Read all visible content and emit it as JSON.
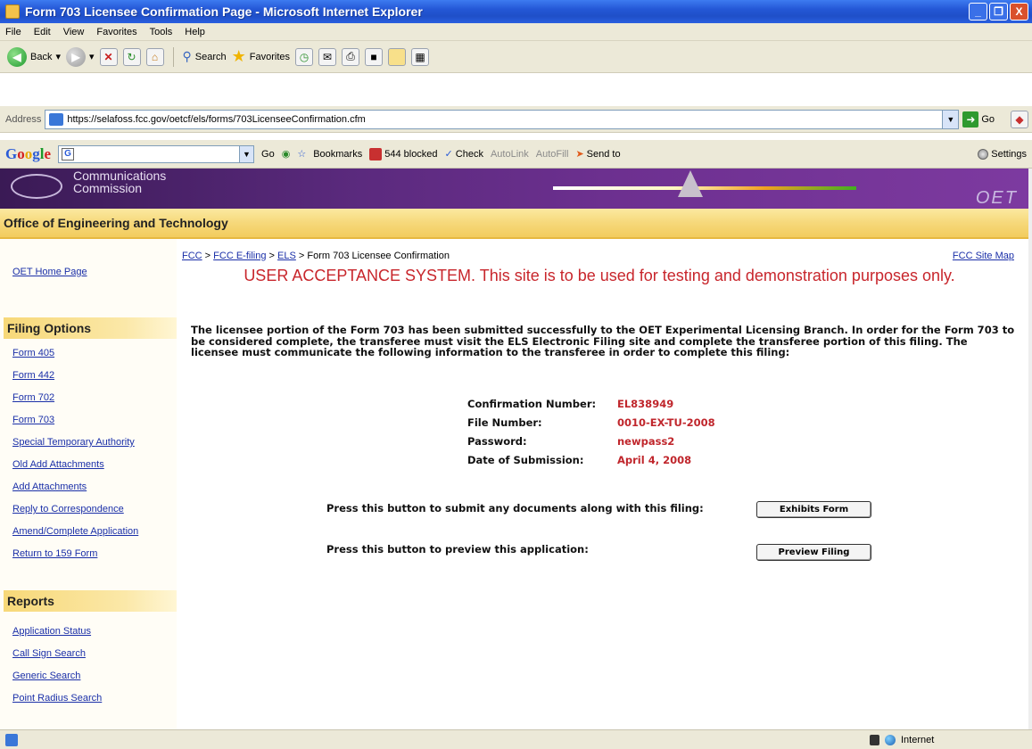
{
  "window": {
    "title": "Form 703 Licensee Confirmation Page - Microsoft Internet Explorer",
    "minimize": "_",
    "maximize": "❐",
    "close": "X"
  },
  "menu": [
    "File",
    "Edit",
    "View",
    "Favorites",
    "Tools",
    "Help"
  ],
  "toolbar": {
    "back_label": "Back",
    "search_label": "Search",
    "favorites_label": "Favorites"
  },
  "address": {
    "label": "Address",
    "url": "https://selafoss.fcc.gov/oetcf/els/forms/703LicenseeConfirmation.cfm",
    "go_label": "Go"
  },
  "google_toolbar": {
    "go": "Go",
    "bookmarks": "Bookmarks",
    "blocked": "544 blocked",
    "check": "Check",
    "autolink": "AutoLink",
    "autofill": "AutoFill",
    "send_to": "Send to",
    "settings": "Settings"
  },
  "banner": {
    "org_line1": "Communications",
    "org_line2": "Commission",
    "oet_mark": "OET"
  },
  "office_title": "Office of Engineering and Technology",
  "sidebar": {
    "home": "OET Home Page",
    "filing_heading": "Filing Options",
    "filing_items": [
      "Form 405",
      "Form 442",
      "Form 702",
      "Form 703",
      "Special Temporary Authority",
      "Old Add Attachments",
      "Add Attachments",
      "Reply to Correspondence",
      "Amend/Complete Application",
      "Return to 159 Form"
    ],
    "reports_heading": "Reports",
    "report_items": [
      "Application Status",
      "Call Sign Search",
      "Generic Search",
      "Point Radius Search"
    ]
  },
  "breadcrumb": {
    "fcc": "FCC",
    "efiling": "FCC E-filing",
    "els": "ELS",
    "sep": ">",
    "current": "Form 703 Licensee Confirmation"
  },
  "site_map": "FCC Site Map",
  "uat_notice": "USER ACCEPTANCE SYSTEM. This site is to be used for testing and demonstration purposes only.",
  "intro_text": "The licensee portion of the Form 703 has been submitted successfully to the OET Experimental Licensing Branch. In order for the Form 703 to be considered complete, the transferee must visit the ELS Electronic Filing site and complete the transferee portion of this filing. The licensee must communicate the following information to the transferee in order to complete this filing:",
  "confirmation": [
    {
      "label": "Confirmation Number:",
      "value": "EL838949"
    },
    {
      "label": "File Number:",
      "value": "0010-EX-TU-2008"
    },
    {
      "label": "Password:",
      "value": "newpass2"
    },
    {
      "label": "Date of Submission:",
      "value": "April 4, 2008"
    }
  ],
  "actions": [
    {
      "prompt": "Press this button to submit any documents along with this filing:",
      "button": "Exhibits Form"
    },
    {
      "prompt": "Press this button to preview this application:",
      "button": "Preview Filing"
    }
  ],
  "status": {
    "zone": "Internet"
  }
}
